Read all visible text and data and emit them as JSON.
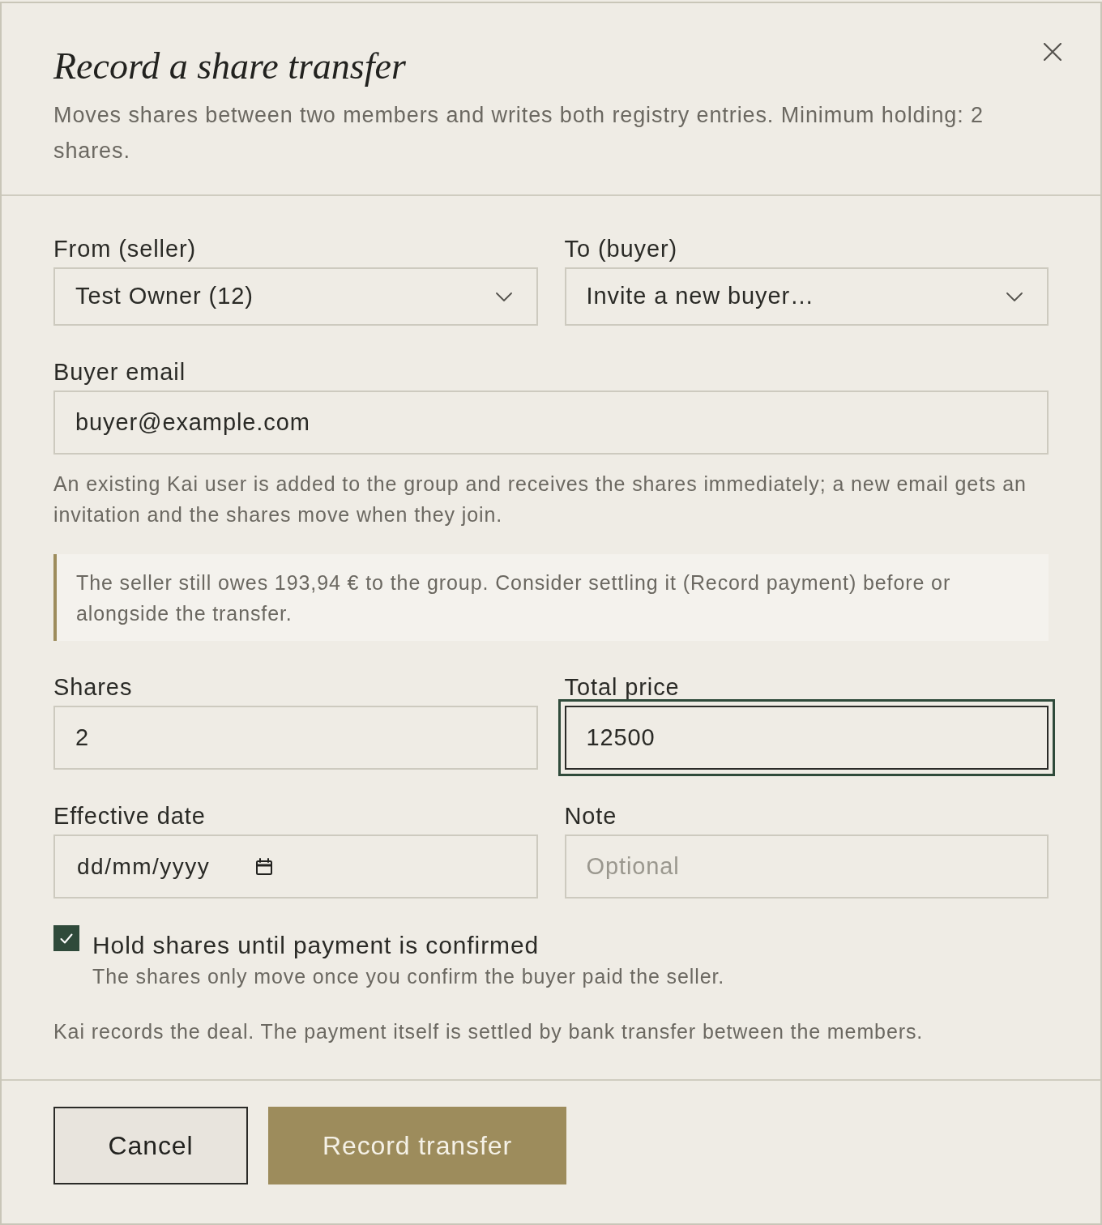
{
  "dialog": {
    "title": "Record a share transfer",
    "subtitle": "Moves shares between two members and writes both registry entries. Minimum holding: 2 shares."
  },
  "sections": [
    {
      "kind": "fields",
      "fields": [
        {
          "kind": "select",
          "label": "From (seller)",
          "value": "Test Owner (12)",
          "focused": false
        },
        {
          "kind": "select",
          "label": "To (buyer)",
          "value": "Invite a new buyer…",
          "focused": false
        }
      ]
    },
    {
      "kind": "fields",
      "fields": [
        {
          "kind": "input",
          "label": "Buyer email",
          "value": "buyer@example.com",
          "focused": false
        }
      ]
    },
    {
      "kind": "hint",
      "text": "An existing Kai user is added to the group and receives the shares immediately; a new email gets an invitation and the shares move when they join."
    },
    {
      "kind": "callout",
      "text": "The seller still owes 193,94 € to the group. Consider settling it (Record payment) before or alongside the transfer."
    },
    {
      "kind": "fields",
      "fields": [
        {
          "kind": "input",
          "label": "Shares",
          "value": "2",
          "focused": false
        },
        {
          "kind": "input",
          "label": "Total price",
          "value": "12500",
          "focused": true
        }
      ]
    },
    {
      "kind": "fields",
      "fields": [
        {
          "kind": "date",
          "label": "Effective date",
          "placeholder": "dd/mm/yyyy",
          "focused": false
        },
        {
          "kind": "input",
          "label": "Note",
          "placeholder": "Optional",
          "focused": false
        }
      ]
    },
    {
      "kind": "checkbox",
      "label": "Hold shares until payment is confirmed",
      "description": "The shares only move once you confirm the buyer paid the seller.",
      "checked": true
    },
    {
      "kind": "note",
      "text": "Kai records the deal. The payment itself is settled by bank transfer between the members."
    }
  ],
  "buttons": [
    {
      "kind": "secondary",
      "label": "Cancel"
    },
    {
      "kind": "primary",
      "label": "Record transfer"
    }
  ]
}
